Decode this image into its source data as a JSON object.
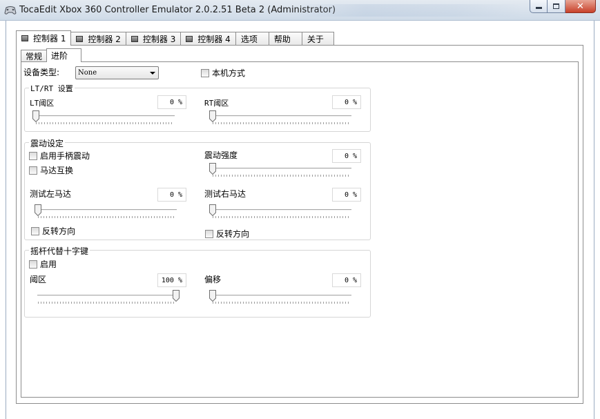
{
  "window": {
    "title": "TocaEdit Xbox 360 Controller Emulator 2.0.2.51 Beta 2 (Administrator)",
    "close_symbol": "✕"
  },
  "tabs": [
    {
      "label": "控制器 1",
      "icon": "controller-square-icon"
    },
    {
      "label": "控制器 2",
      "icon": "controller-square-icon"
    },
    {
      "label": "控制器 3",
      "icon": "controller-square-icon"
    },
    {
      "label": "控制器 4",
      "icon": "controller-square-icon"
    },
    {
      "label": "选项"
    },
    {
      "label": "帮助"
    },
    {
      "label": "关于"
    }
  ],
  "active_tab": 0,
  "subtabs": [
    {
      "label": "常规"
    },
    {
      "label": "进阶"
    }
  ],
  "active_subtab": 1,
  "device": {
    "type_label": "设备类型:",
    "type_value": "None",
    "native_mode_label": "本机方式",
    "native_mode_checked": false
  },
  "ltrt": {
    "title": "LT/RT 设置",
    "lt_label": "LT阈区",
    "lt_value": "0 %",
    "lt_level": 0,
    "rt_label": "RT阈区",
    "rt_value": "0 %",
    "rt_level": 0
  },
  "vibration": {
    "title": "震动设定",
    "enable_label": "启用手柄震动",
    "enable_checked": false,
    "swap_label": "马达互换",
    "swap_checked": false,
    "strength_label": "震动强度",
    "strength_value": "0 %",
    "strength_level": 0,
    "left_label": "测试左马达",
    "left_value": "0 %",
    "left_level": 0,
    "left_invert_label": "反转方向",
    "right_label": "测试右马达",
    "right_value": "0 %",
    "right_level": 0,
    "right_invert_label": "反转方向"
  },
  "dpad": {
    "title": "摇杆代替十字键",
    "enable_label": "启用",
    "enable_checked": false,
    "deadzone_label": "阈区",
    "deadzone_value": "100 %",
    "deadzone_level": 1,
    "offset_label": "偏移",
    "offset_value": "0 %",
    "offset_level": 0
  }
}
